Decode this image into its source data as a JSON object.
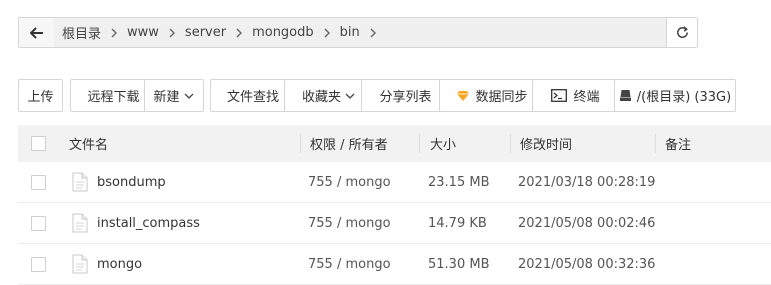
{
  "pathbar": {
    "crumbs": [
      "根目录",
      "www",
      "server",
      "mongodb",
      "bin"
    ]
  },
  "toolbar": {
    "upload": "上传",
    "remote_download": "远程下载",
    "new": "新建",
    "file_search": "文件查找",
    "favorites": "收藏夹",
    "share_list": "分享列表",
    "data_sync": "数据同步",
    "terminal": "终端",
    "disk": "/(根目录) (33G)"
  },
  "table": {
    "headers": {
      "name": "文件名",
      "perm": "权限 / 所有者",
      "size": "大小",
      "mtime": "修改时间",
      "note": "备注"
    },
    "rows": [
      {
        "name": "bsondump",
        "perm": "755 / mongo",
        "size": "23.15 MB",
        "mtime": "2021/03/18 00:28:19",
        "note": ""
      },
      {
        "name": "install_compass",
        "perm": "755 / mongo",
        "size": "14.79 KB",
        "mtime": "2021/05/08 00:02:46",
        "note": ""
      },
      {
        "name": "mongo",
        "perm": "755 / mongo",
        "size": "51.30 MB",
        "mtime": "2021/05/08 00:32:36",
        "note": ""
      }
    ]
  },
  "colors": {
    "sync_icon": "#f5a623",
    "header_bg": "#f2f2f2",
    "path_bg": "#f0f0f0"
  }
}
